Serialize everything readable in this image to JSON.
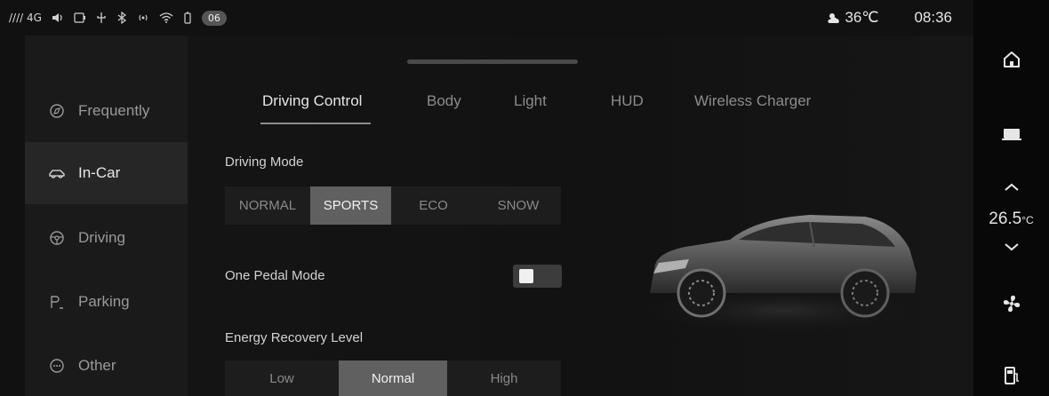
{
  "status_bar": {
    "signal": "//// 4G",
    "badge": "06",
    "weather": "36℃",
    "time": "08:36",
    "icons": [
      "volume-icon",
      "media-icon",
      "usb-icon",
      "bluetooth-icon",
      "hotspot-icon",
      "wifi-icon",
      "battery-icon"
    ]
  },
  "sidebar": {
    "items": [
      {
        "label": "Frequently",
        "icon": "frequently-icon",
        "active": false
      },
      {
        "label": "In-Car",
        "icon": "car-outline-icon",
        "active": true
      },
      {
        "label": "Driving",
        "icon": "steering-wheel-icon",
        "active": false
      },
      {
        "label": "Parking",
        "icon": "parking-icon",
        "active": false
      },
      {
        "label": "Other",
        "icon": "more-icon",
        "active": false
      }
    ]
  },
  "tabs": [
    {
      "label": "Driving Control",
      "active": true
    },
    {
      "label": "Body",
      "active": false
    },
    {
      "label": "Light",
      "active": false
    },
    {
      "label": "HUD",
      "active": false
    },
    {
      "label": "Wireless Charger",
      "active": false
    }
  ],
  "driving_mode": {
    "label": "Driving Mode",
    "options": [
      "NORMAL",
      "SPORTS",
      "ECO",
      "SNOW"
    ],
    "selected": "SPORTS"
  },
  "one_pedal": {
    "label": "One Pedal Mode",
    "enabled": false
  },
  "energy_recovery": {
    "label": "Energy Recovery Level",
    "options": [
      "Low",
      "Normal",
      "High"
    ],
    "selected": "Normal"
  },
  "right_rail": {
    "temperature": "26.5",
    "temperature_unit": "°C",
    "icons": [
      "home-icon",
      "screen-icon",
      "temp-up-icon",
      "temp-down-icon",
      "fan-icon",
      "fuel-icon"
    ]
  }
}
